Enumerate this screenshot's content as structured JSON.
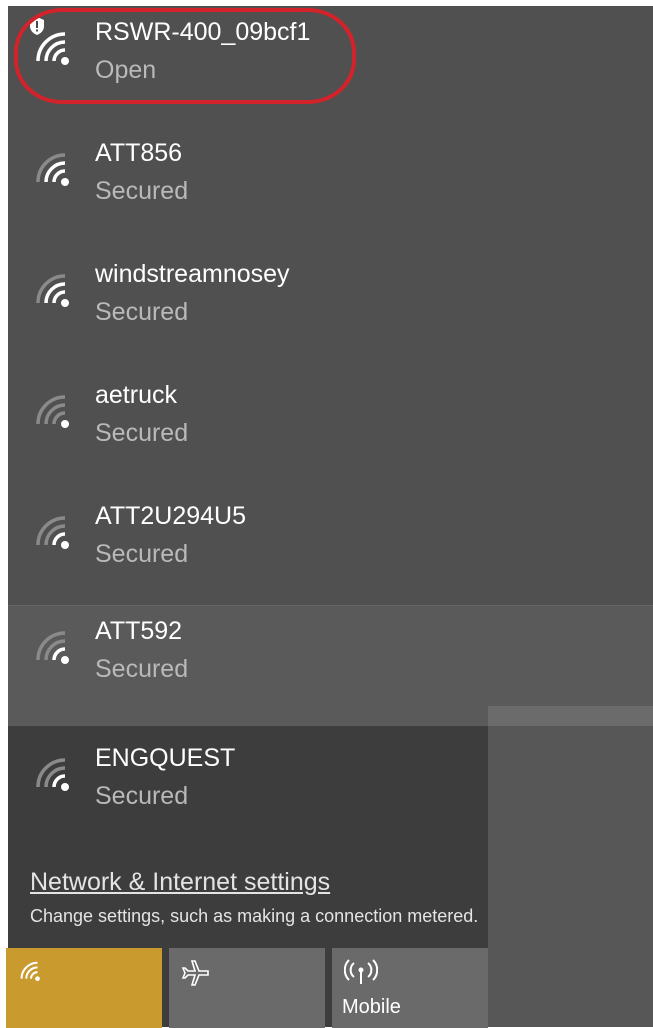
{
  "networks": [
    {
      "name": "RSWR-400_09bcf1",
      "status": "Open",
      "icon": "wifi-signal-icon",
      "warning_icon": "shield-warning-icon"
    },
    {
      "name": "ATT856",
      "status": "Secured",
      "icon": "wifi-signal-icon"
    },
    {
      "name": "windstreamnosey",
      "status": "Secured",
      "icon": "wifi-signal-icon"
    },
    {
      "name": "aetruck",
      "status": "Secured",
      "icon": "wifi-signal-icon"
    },
    {
      "name": "ATT2U294U5",
      "status": "Secured",
      "icon": "wifi-signal-icon"
    },
    {
      "name": "ATT592",
      "status": "Secured",
      "icon": "wifi-signal-icon"
    },
    {
      "name": "ENGQUEST",
      "status": "Secured",
      "icon": "wifi-signal-icon"
    }
  ],
  "settings": {
    "link_label": "Network & Internet settings",
    "description": "Change settings, such as making a connection metered."
  },
  "quick_actions": [
    {
      "label": "",
      "icon": "wifi-icon",
      "active": true,
      "color": "#c99a2e"
    },
    {
      "label": "",
      "icon": "airplane-icon",
      "active": false
    },
    {
      "label": "Mobile",
      "icon": "mobile-hotspot-icon",
      "active": false
    }
  ],
  "colors": {
    "highlight_ring": "#d2232a",
    "panel_bg": "#4a4a4a",
    "accent": "#c99a2e"
  }
}
